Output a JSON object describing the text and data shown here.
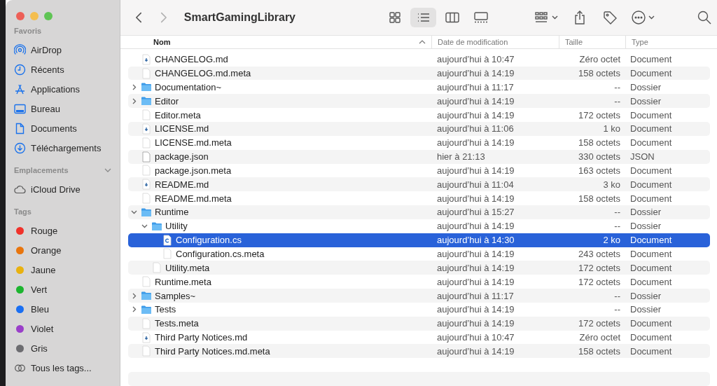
{
  "sidebar": {
    "sections": [
      {
        "title": "Favoris",
        "toggle": false,
        "items": [
          {
            "kind": "airdrop",
            "label": "AirDrop"
          },
          {
            "kind": "recents",
            "label": "Récents"
          },
          {
            "kind": "applications",
            "label": "Applications"
          },
          {
            "kind": "desktop",
            "label": "Bureau"
          },
          {
            "kind": "documents",
            "label": "Documents"
          },
          {
            "kind": "downloads",
            "label": "Téléchargements"
          }
        ]
      },
      {
        "title": "Emplacements",
        "toggle": true,
        "items": [
          {
            "kind": "icloud",
            "label": "iCloud Drive"
          }
        ]
      },
      {
        "title": "Tags",
        "toggle": false,
        "items": [
          {
            "kind": "tag",
            "label": "Rouge",
            "color": "#f0322a"
          },
          {
            "kind": "tag",
            "label": "Orange",
            "color": "#e8750d"
          },
          {
            "kind": "tag",
            "label": "Jaune",
            "color": "#e9b10f"
          },
          {
            "kind": "tag",
            "label": "Vert",
            "color": "#1db52f"
          },
          {
            "kind": "tag",
            "label": "Bleu",
            "color": "#1a6ff2"
          },
          {
            "kind": "tag",
            "label": "Violet",
            "color": "#9a3fc9"
          },
          {
            "kind": "tag",
            "label": "Gris",
            "color": "#6c6c70"
          },
          {
            "kind": "all-tags",
            "label": "Tous les tags..."
          }
        ]
      }
    ]
  },
  "toolbar": {
    "nav": [
      {
        "kind": "back",
        "disabled": false
      },
      {
        "kind": "forward",
        "disabled": true
      }
    ],
    "title": "SmartGamingLibrary",
    "view_modes": [
      {
        "kind": "icons",
        "selected": false
      },
      {
        "kind": "list",
        "selected": true
      },
      {
        "kind": "columns",
        "selected": false
      },
      {
        "kind": "gallery",
        "selected": false
      }
    ],
    "actions": [
      {
        "kind": "group",
        "menu": true
      },
      {
        "kind": "share",
        "menu": false
      },
      {
        "kind": "tag",
        "menu": false
      },
      {
        "kind": "more",
        "menu": true
      },
      {
        "kind": "search",
        "menu": false
      }
    ]
  },
  "table": {
    "columns": [
      {
        "label": "Nom",
        "sorted": true
      },
      {
        "label": "Date de modification",
        "sorted": false
      },
      {
        "label": "Taille",
        "sorted": false
      },
      {
        "label": "Type",
        "sorted": false
      }
    ],
    "rows": [
      {
        "kind": "markdown",
        "name": "CHANGELOG.md",
        "date": "aujourd’hui à 10:47",
        "size": "Zéro octet",
        "type": "Document",
        "selected": false
      },
      {
        "kind": "file",
        "name": "CHANGELOG.md.meta",
        "date": "aujourd’hui à 14:19",
        "size": "158 octets",
        "type": "Document",
        "selected": false
      },
      {
        "kind": "folder",
        "name": "Documentation~",
        "date": "aujourd’hui à 11:17",
        "size": "--",
        "type": "Dossier",
        "selected": false,
        "expanded": false
      },
      {
        "kind": "folder",
        "name": "Editor",
        "date": "aujourd’hui à 14:19",
        "size": "--",
        "type": "Dossier",
        "selected": false,
        "expanded": false
      },
      {
        "kind": "file",
        "name": "Editor.meta",
        "date": "aujourd’hui à 14:19",
        "size": "172 octets",
        "type": "Document",
        "selected": false
      },
      {
        "kind": "markdown",
        "name": "LICENSE.md",
        "date": "aujourd’hui à 11:06",
        "size": "1 ko",
        "type": "Document",
        "selected": false
      },
      {
        "kind": "file",
        "name": "LICENSE.md.meta",
        "date": "aujourd’hui à 14:19",
        "size": "158 octets",
        "type": "Document",
        "selected": false
      },
      {
        "kind": "json",
        "name": "package.json",
        "date": "hier à 21:13",
        "size": "330 octets",
        "type": "JSON",
        "selected": false
      },
      {
        "kind": "file",
        "name": "package.json.meta",
        "date": "aujourd’hui à 14:19",
        "size": "163 octets",
        "type": "Document",
        "selected": false
      },
      {
        "kind": "markdown",
        "name": "README.md",
        "date": "aujourd’hui à 11:04",
        "size": "3 ko",
        "type": "Document",
        "selected": false
      },
      {
        "kind": "file",
        "name": "README.md.meta",
        "date": "aujourd’hui à 14:19",
        "size": "158 octets",
        "type": "Document",
        "selected": false
      },
      {
        "kind": "folder",
        "name": "Runtime",
        "date": "aujourd’hui à 15:27",
        "size": "--",
        "type": "Dossier",
        "selected": false,
        "expanded": true,
        "children": [
          {
            "kind": "folder",
            "name": "Utility",
            "date": "aujourd’hui à 14:19",
            "size": "--",
            "type": "Dossier",
            "selected": false,
            "expanded": true,
            "children": [
              {
                "kind": "csharp",
                "name": "Configuration.cs",
                "date": "aujourd’hui à 14:30",
                "size": "2 ko",
                "type": "Document",
                "selected": true
              },
              {
                "kind": "file",
                "name": "Configuration.cs.meta",
                "date": "aujourd’hui à 14:19",
                "size": "243 octets",
                "type": "Document",
                "selected": false
              }
            ]
          },
          {
            "kind": "file",
            "name": "Utility.meta",
            "date": "aujourd’hui à 14:19",
            "size": "172 octets",
            "type": "Document",
            "selected": false
          }
        ]
      },
      {
        "kind": "file",
        "name": "Runtime.meta",
        "date": "aujourd’hui à 14:19",
        "size": "172 octets",
        "type": "Document",
        "selected": false
      },
      {
        "kind": "folder",
        "name": "Samples~",
        "date": "aujourd’hui à 11:17",
        "size": "--",
        "type": "Dossier",
        "selected": false,
        "expanded": false
      },
      {
        "kind": "folder",
        "name": "Tests",
        "date": "aujourd’hui à 14:19",
        "size": "--",
        "type": "Dossier",
        "selected": false,
        "expanded": false
      },
      {
        "kind": "file",
        "name": "Tests.meta",
        "date": "aujourd’hui à 14:19",
        "size": "172 octets",
        "type": "Document",
        "selected": false
      },
      {
        "kind": "markdown",
        "name": "Third Party Notices.md",
        "date": "aujourd’hui à 10:47",
        "size": "Zéro octet",
        "type": "Document",
        "selected": false
      },
      {
        "kind": "file",
        "name": "Third Party Notices.md.meta",
        "date": "aujourd’hui à 14:19",
        "size": "158 octets",
        "type": "Document",
        "selected": false
      }
    ]
  }
}
